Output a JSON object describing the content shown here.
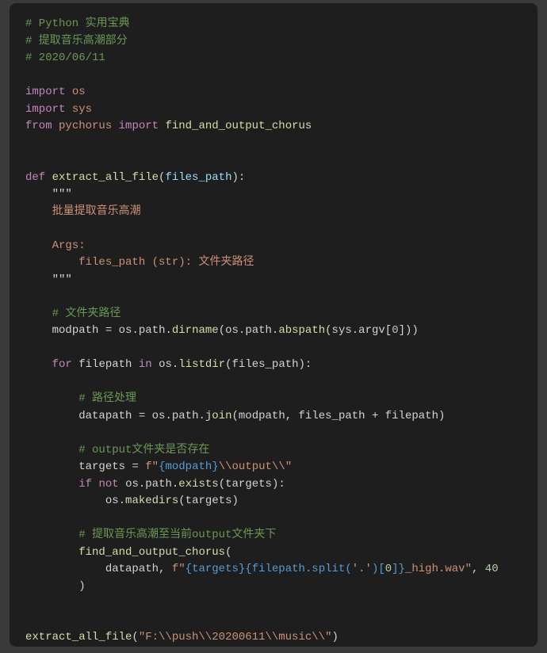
{
  "code": {
    "comment_header_1": "# Python 实用宝典",
    "comment_header_2": "# 提取音乐高潮部分",
    "comment_header_3": "# 2020/06/11",
    "kw_import_1": "import",
    "mod_os": "os",
    "kw_import_2": "import",
    "mod_sys": "sys",
    "kw_from": "from",
    "mod_pychorus": "pychorus",
    "kw_import_3": "import",
    "func_find_and_output_chorus": "find_and_output_chorus",
    "kw_def": "def",
    "func_extract_all_file": "extract_all_file",
    "param_files_path": "files_path",
    "triple_quote_open": "\"\"\"",
    "docstr_line1": "批量提取音乐高潮",
    "docstr_args": "Args:",
    "docstr_param_line": "    files_path (str): 文件夹路径",
    "triple_quote_close": "\"\"\"",
    "comment_folder_path": "# 文件夹路径",
    "var_modpath": "modpath",
    "member_os": "os",
    "member_path": "path",
    "func_dirname": "dirname",
    "func_abspath": "abspath",
    "member_sys": "sys",
    "member_argv": "argv",
    "num_zero": "0",
    "kw_for": "for",
    "var_filepath": "filepath",
    "kw_in": "in",
    "func_listdir": "listdir",
    "comment_path_process": "# 路径处理",
    "var_datapath": "datapath",
    "func_join": "join",
    "comment_output_exists": "# output文件夹是否存在",
    "var_targets": "targets",
    "str_f_prefix": "f\"",
    "interp_modpath": "{modpath}",
    "str_output_suffix": "\\\\output\\\\\"",
    "kw_if": "if",
    "kw_not": "not",
    "func_exists": "exists",
    "func_makedirs": "makedirs",
    "comment_extract_to_output": "# 提取音乐高潮至当前output文件夹下",
    "interp_targets": "{targets}",
    "interp_filepath_split_open": "{filepath.split(",
    "str_dot": "'.'",
    "interp_filepath_split_close": ")[",
    "str_high_wav": "_high.wav\"",
    "num_forty": "40",
    "call_final_arg": "\"F:\\\\push\\\\20200611\\\\music\\\\\""
  }
}
